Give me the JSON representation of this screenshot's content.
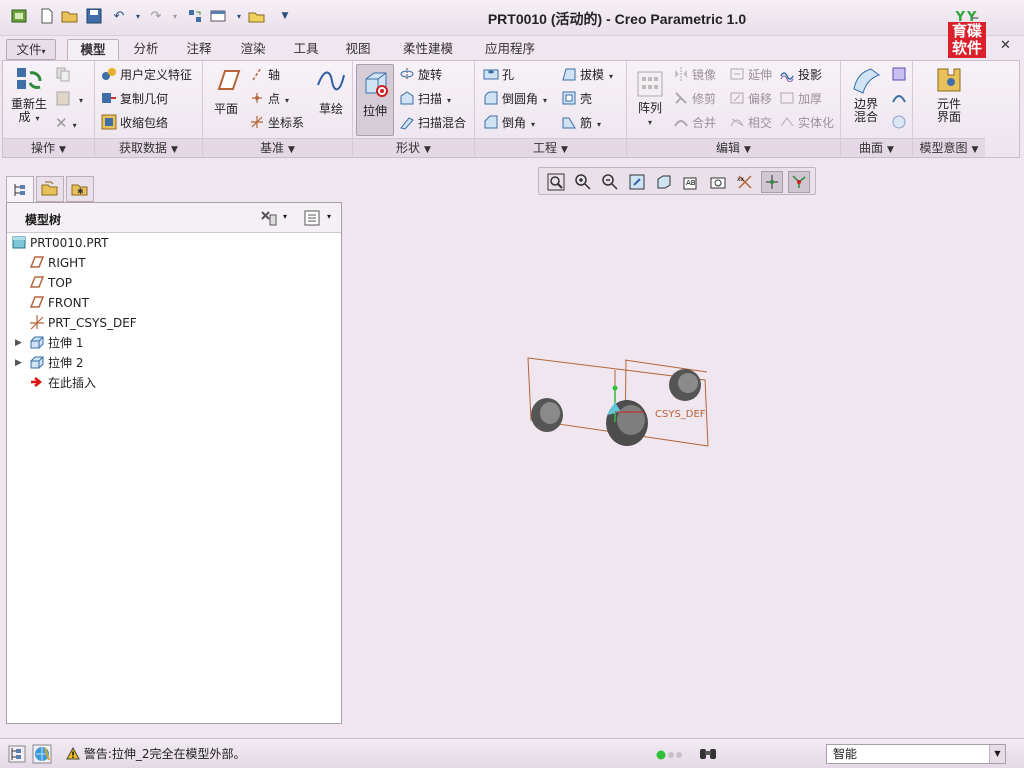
{
  "window": {
    "title": "PRT0010 (活动的) - Creo Parametric 1.0",
    "brand_top": "YY",
    "brand_text": "育碟软件",
    "minimize": "–",
    "close": "✕"
  },
  "tabs": [
    {
      "label": "文件",
      "arrow": "▾"
    },
    {
      "label": "模型"
    },
    {
      "label": "分析"
    },
    {
      "label": "注释"
    },
    {
      "label": "渲染"
    },
    {
      "label": "工具"
    },
    {
      "label": "视图"
    },
    {
      "label": "柔性建模"
    },
    {
      "label": "应用程序"
    }
  ],
  "ribbon": {
    "operations": {
      "regenerate": "重新生成",
      "footer": "操作"
    },
    "get_data": {
      "user_defined_feature": "用户定义特征",
      "copy_geometry": "复制几何",
      "shrinkwrap": "收缩包络",
      "footer": "获取数据"
    },
    "datum": {
      "plane": "平面",
      "axis": "轴",
      "point": "点",
      "csys": "坐标系",
      "sketch": "草绘",
      "footer": "基准"
    },
    "shapes": {
      "extrude": "拉伸",
      "revolve": "旋转",
      "sweep": "扫描",
      "swept_blend": "扫描混合",
      "footer": "形状"
    },
    "engineering": {
      "hole": "孔",
      "round": "倒圆角",
      "chamfer": "倒角",
      "draft": "拔模",
      "shell": "壳",
      "rib": "筋",
      "footer": "工程"
    },
    "editing": {
      "pattern": "阵列",
      "mirror": "镜像",
      "trim": "修剪",
      "merge": "合并",
      "extend": "延伸",
      "offset": "偏移",
      "intersect": "相交",
      "project": "投影",
      "thicken": "加厚",
      "solidify": "实体化",
      "footer": "编辑"
    },
    "surfaces": {
      "boundary_blend": "边界混合",
      "footer": "曲面"
    },
    "model_intent": {
      "component_interface": "元件界面",
      "footer": "模型意图"
    }
  },
  "model_tree": {
    "title": "模型树",
    "items": [
      {
        "label": "PRT0010.PRT",
        "icon": "part-icon"
      },
      {
        "label": "RIGHT",
        "icon": "datum-plane-icon"
      },
      {
        "label": "TOP",
        "icon": "datum-plane-icon"
      },
      {
        "label": "FRONT",
        "icon": "datum-plane-icon"
      },
      {
        "label": "PRT_CSYS_DEF",
        "icon": "csys-icon"
      },
      {
        "label": "拉伸 1",
        "icon": "extrude-icon"
      },
      {
        "label": "拉伸 2",
        "icon": "extrude-icon"
      },
      {
        "label": "在此插入",
        "icon": "insert-here-icon"
      }
    ]
  },
  "graphics": {
    "csys_label": "CSYS_DEF"
  },
  "status": {
    "message": "警告:拉伸_2完全在模型外部。",
    "filter_value": "智能"
  },
  "colors": {
    "ribbon_bg": "#f4eef5",
    "datum_orange": "#b5653a",
    "model_gray": "#6b6b6b"
  }
}
